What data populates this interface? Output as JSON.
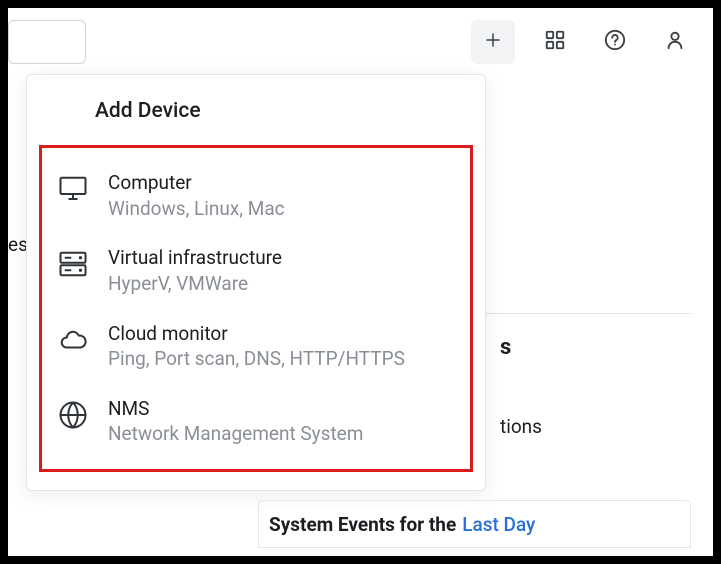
{
  "topbar": {
    "plus_icon": "plus",
    "grid_icon": "grid",
    "help_icon": "help",
    "user_icon": "user"
  },
  "panel": {
    "title": "Add Device",
    "options": [
      {
        "name": "computer",
        "title": "Computer",
        "subtitle": "Windows, Linux, Mac"
      },
      {
        "name": "virtual-infrastructure",
        "title": "Virtual infrastructure",
        "subtitle": "HyperV, VMWare"
      },
      {
        "name": "cloud-monitor",
        "title": "Cloud monitor",
        "subtitle": "Ping, Port scan, DNS, HTTP/HTTPS"
      },
      {
        "name": "nms",
        "title": "NMS",
        "subtitle": "Network Management System"
      }
    ]
  },
  "background": {
    "leak_es": "es",
    "leak_s": "s",
    "leak_tions": "tions",
    "sys_events_label": "System Events for the",
    "sys_events_link": "Last Day"
  },
  "annotation": {
    "highlight_color": "#d91c1c"
  }
}
